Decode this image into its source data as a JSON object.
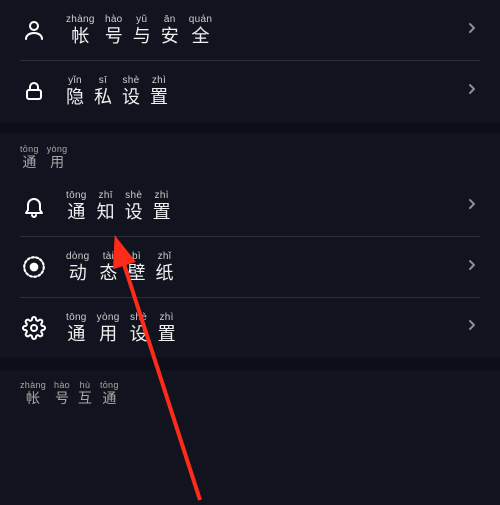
{
  "group1": {
    "items": [
      {
        "pinyin": [
          "zhàng",
          "hào",
          "yǔ",
          "ān",
          "quán"
        ],
        "chars": [
          "帐",
          "号",
          "与",
          "安",
          "全"
        ]
      },
      {
        "pinyin": [
          "yǐn",
          "sī",
          "shè",
          "zhì"
        ],
        "chars": [
          "隐",
          "私",
          "设",
          "置"
        ]
      }
    ]
  },
  "section_tongyong": {
    "pinyin": [
      "tōng",
      "yòng"
    ],
    "chars": [
      "通",
      "用"
    ]
  },
  "group2": {
    "items": [
      {
        "pinyin": [
          "tōng",
          "zhī",
          "shè",
          "zhì"
        ],
        "chars": [
          "通",
          "知",
          "设",
          "置"
        ]
      },
      {
        "pinyin": [
          "dòng",
          "tài",
          "bì",
          "zhǐ"
        ],
        "chars": [
          "动",
          "态",
          "壁",
          "纸"
        ]
      },
      {
        "pinyin": [
          "tōng",
          "yòng",
          "shè",
          "zhì"
        ],
        "chars": [
          "通",
          "用",
          "设",
          "置"
        ]
      }
    ]
  },
  "section_hutong": {
    "pinyin": [
      "zhàng",
      "hào",
      "hù",
      "tōng"
    ],
    "chars": [
      "帐",
      "号",
      "互",
      "通"
    ]
  },
  "arrow_color": "#ff2b1a"
}
